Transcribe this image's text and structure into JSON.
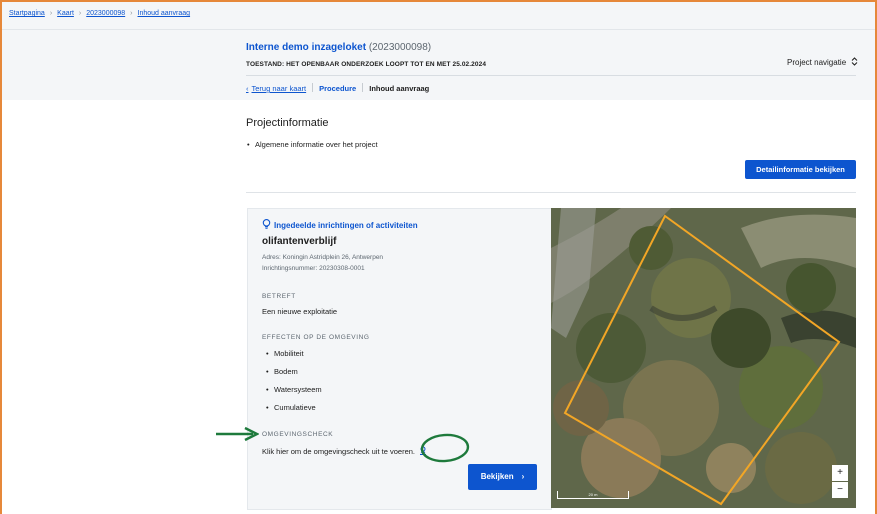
{
  "breadcrumb": {
    "items": [
      "Startpagina",
      "Kaart",
      "2023000098",
      "Inhoud aanvraag"
    ],
    "separator": "›"
  },
  "project": {
    "title": "Interne demo inzageloket",
    "number": "(2023000098)",
    "state": "TOESTAND: HET OPENBAAR ONDERZOEK LOOPT TOT EN MET 25.02.2024",
    "nav_label": "Project navigatie",
    "nav_icon": "chevron-updown-icon"
  },
  "subnav": {
    "back_label": "Terug naar kaart",
    "procedure_label": "Procedure",
    "current_label": "Inhoud aanvraag"
  },
  "projectinformatie": {
    "title": "Projectinformatie",
    "bullet": "Algemene informatie over het project",
    "detail_button": "Detailinformatie bekijken"
  },
  "card": {
    "header": "Ingedeelde inrichtingen of activiteiten",
    "header_icon": "bulb-icon",
    "title": "olifantenverblijf",
    "address": "Adres: Koningin Astridplein 26, Antwerpen",
    "number": "Inrichtingsnummer: 20230308-0001",
    "betreft_label": "BETREFT",
    "betreft_value": "Een nieuwe exploitatie",
    "effects_label": "EFFECTEN OP DE OMGEVING",
    "effects": [
      "Mobiliteit",
      "Bodem",
      "Watersysteem",
      "Cumulatieve"
    ],
    "check_label": "OMGEVINGSCHECK",
    "check_text": "Klik hier om de omgevingscheck uit te voeren.",
    "check_icon": "user-pin-icon",
    "button": "Bekijken"
  },
  "map": {
    "zoom_in": "+",
    "zoom_out": "−",
    "scale_label": "20 m",
    "boundary_color": "#f2a626"
  },
  "annotation": {
    "color": "#1e7a3c"
  }
}
